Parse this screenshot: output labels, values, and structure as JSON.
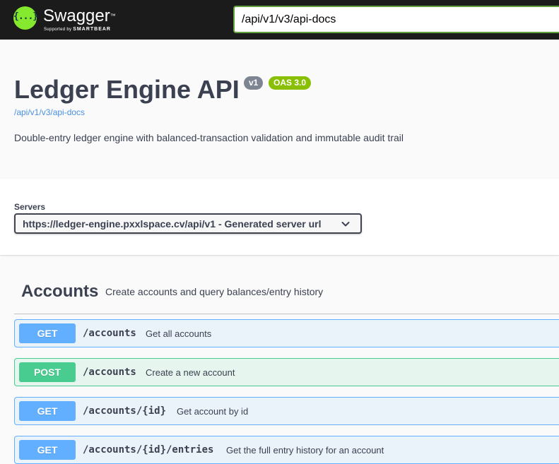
{
  "topbar": {
    "logo_glyph": "{...}",
    "brand_name": "Swagger",
    "brand_tm": "™",
    "brand_sub_prefix": "Supported by",
    "brand_sub_company": "SMARTBEAR",
    "url_value": "/api/v1/v3/api-docs"
  },
  "info": {
    "title": "Ledger Engine API",
    "version_badge": "v1",
    "oas_badge": "OAS 3.0",
    "docs_link": "/api/v1/v3/api-docs",
    "description": "Double-entry ledger engine with balanced-transaction validation and immutable audit trail"
  },
  "servers": {
    "label": "Servers",
    "selected": "https://ledger-engine.pxxlspace.cv/api/v1 - Generated server url"
  },
  "tag": {
    "name": "Accounts",
    "description": "Create accounts and query balances/entry history"
  },
  "operations": [
    {
      "method": "GET",
      "path": "/accounts",
      "summary": "Get all accounts"
    },
    {
      "method": "POST",
      "path": "/accounts",
      "summary": "Create a new account"
    },
    {
      "method": "GET",
      "path": "/accounts/{id}",
      "summary": "Get account by id"
    },
    {
      "method": "GET",
      "path": "/accounts/{id}/entries",
      "summary": "Get the full entry history for an account"
    }
  ],
  "colors": {
    "topbar": "#1b1b1b",
    "logo": "#85ea2d",
    "get": "#61affe",
    "post": "#49cc90",
    "oas_badge": "#89bf04",
    "version_badge": "#7d8492",
    "link": "#4990e2"
  }
}
